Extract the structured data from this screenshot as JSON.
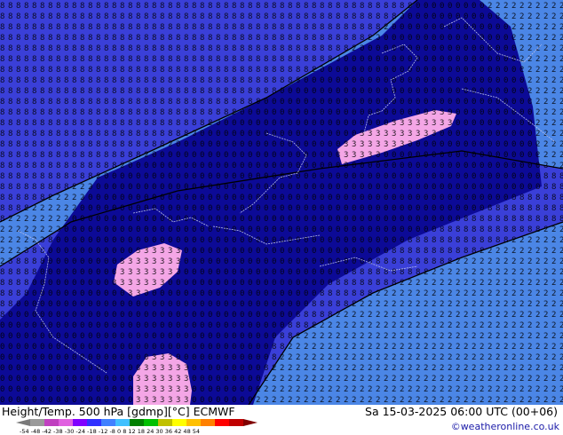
{
  "map": {
    "title": "Height/Temp. 500 hPa [gdmp][°C] ECMWF",
    "valid_time": "Sa 15-03-2025 06:00 UTC (00+06)",
    "credit": "©weatheronline.co.uk",
    "colors": {
      "deep_blue": "#0c0a96",
      "mid_blue": "#3a3fd8",
      "light_blue": "#4b86e6",
      "pink": "#f4a6e6",
      "contour": "#000000",
      "coastline": "#b9bfe8"
    },
    "field_labels": {
      "light_blue": "2",
      "mid_blue": "8",
      "deep_blue": "0",
      "pink": "3"
    },
    "legend": {
      "ticks": "-54 -48 -42 -38 -30 -24 -18 -12 -8  0  8  12  18  24  30  36  42  48  54",
      "colors": [
        "#7a7a7a",
        "#9a9a9a",
        "#c040c0",
        "#e060e0",
        "#8000ff",
        "#3030ff",
        "#4080ff",
        "#40c0ff",
        "#008000",
        "#00c000",
        "#c0c000",
        "#ffff00",
        "#ffc000",
        "#ff8000",
        "#ff0000",
        "#c00000",
        "#800000"
      ]
    }
  }
}
